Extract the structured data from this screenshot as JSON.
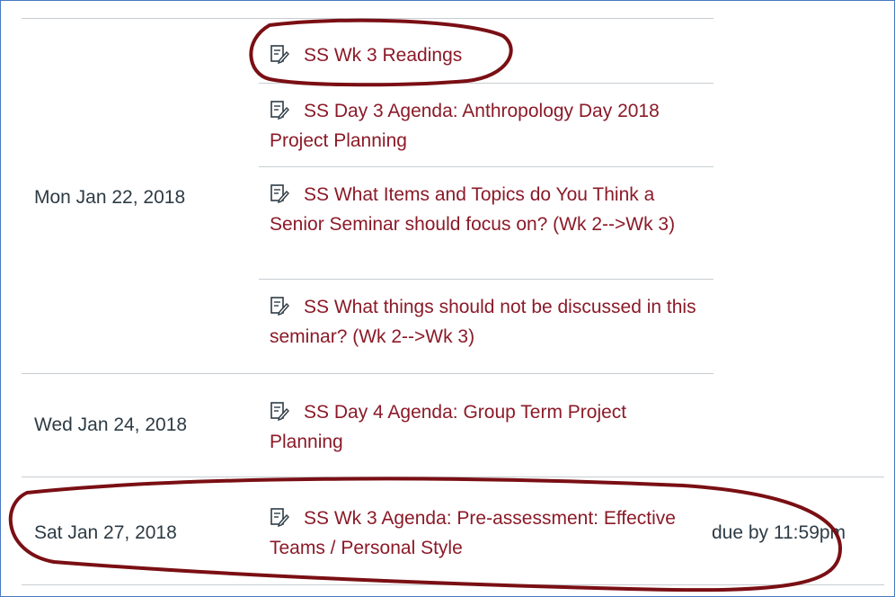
{
  "schedule": {
    "groups": [
      {
        "date": "Mon Jan 22, 2018",
        "items": [
          {
            "icon": "assignment-edit-icon",
            "title": "SS Wk 3 Readings"
          },
          {
            "icon": "assignment-edit-icon",
            "title": "SS Day 3 Agenda: Anthropology Day 2018 Project Planning"
          },
          {
            "icon": "assignment-edit-icon",
            "title": "SS What Items and Topics do You Think a Senior Seminar should focus on? (Wk 2-->Wk 3)"
          },
          {
            "icon": "assignment-edit-icon",
            "title": "SS What things should not be discussed in this seminar? (Wk 2-->Wk 3)"
          }
        ]
      },
      {
        "date": "Wed Jan 24, 2018",
        "items": [
          {
            "icon": "assignment-edit-icon",
            "title": "SS Day 4 Agenda: Group Term Project Planning"
          }
        ]
      },
      {
        "date": "Sat Jan 27, 2018",
        "items": [
          {
            "icon": "assignment-edit-icon",
            "title": "SS Wk 3 Agenda: Pre-assessment: Effective Teams / Personal Style",
            "due": "due by 11:59pm"
          }
        ]
      }
    ]
  },
  "colors": {
    "link": "#8b1a28",
    "text": "#2d3b45",
    "divider": "#c7cdd1",
    "annotation": "#7a0f14",
    "frame": "#4a78c2"
  }
}
